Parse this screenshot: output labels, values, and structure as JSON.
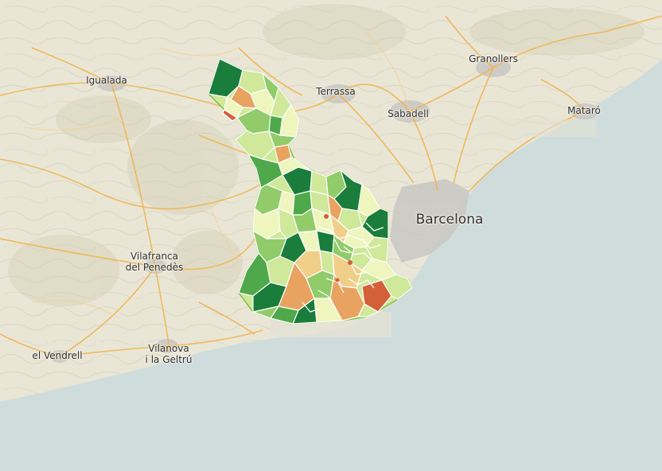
{
  "map": {
    "labels": {
      "igualada": "Igualada",
      "terrassa": "Terrassa",
      "sabadell": "Sabadell",
      "granollers": "Granollers",
      "mataro": "Mataró",
      "barcelona": "Barcelona",
      "vilafranca_line1": "Vilafranca",
      "vilafranca_line2": "del Penedès",
      "vendrell": "el Vendrell",
      "vilanova_line1": "Vilanova",
      "vilanova_line2": "i la Geltrú"
    },
    "colors": {
      "sea": "#cfdcdc",
      "land": "#e9e6d6",
      "roads": "#f2b450",
      "urban": "#c9c7c3",
      "choropleth": [
        "#1a7d3c",
        "#4fa94a",
        "#91cb6a",
        "#cfe89a",
        "#eef5bd",
        "#f0cf8a",
        "#e7a35f",
        "#d4603a"
      ]
    }
  }
}
